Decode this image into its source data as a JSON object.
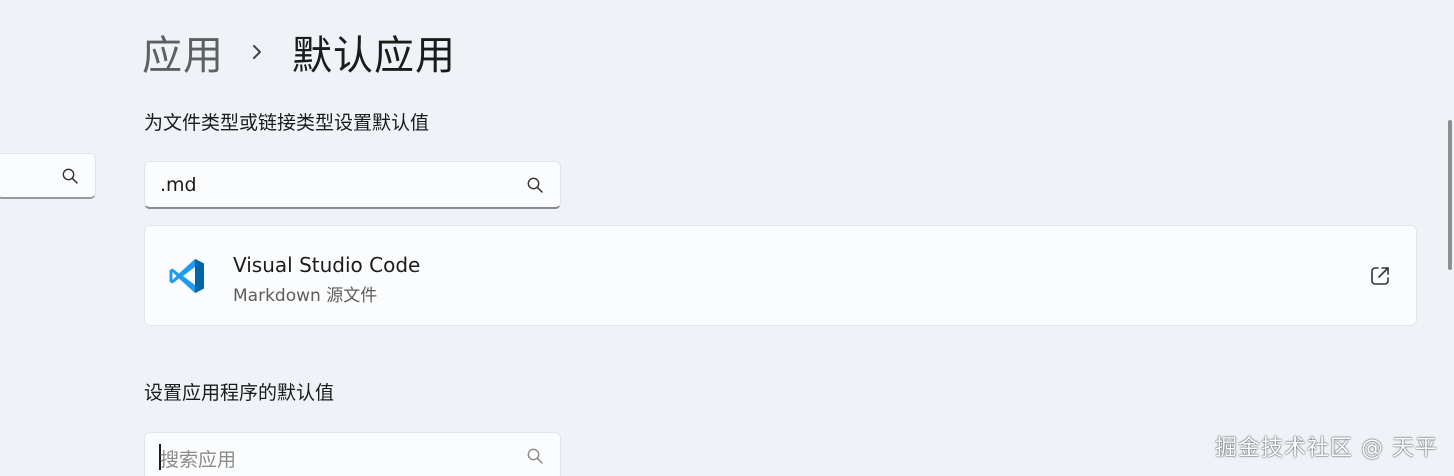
{
  "breadcrumb": {
    "parent": "应用",
    "current": "默认应用"
  },
  "file_type_section": {
    "title": "为文件类型或链接类型设置默认值",
    "search_value": ".md"
  },
  "result": {
    "app_name": "Visual Studio Code",
    "description": "Markdown 源文件"
  },
  "apps_section": {
    "title": "设置应用程序的默认值",
    "search_placeholder": "搜索应用"
  },
  "watermark": "掘金技术社区 @ 天平",
  "icons": {
    "search": "search-icon",
    "chevron": "chevron-right-icon",
    "open": "open-external-icon",
    "app": "vscode-logo"
  },
  "colors": {
    "background": "#eff3f8",
    "card": "#fbfcfd",
    "vscode_blue": "#1f9cf0"
  }
}
